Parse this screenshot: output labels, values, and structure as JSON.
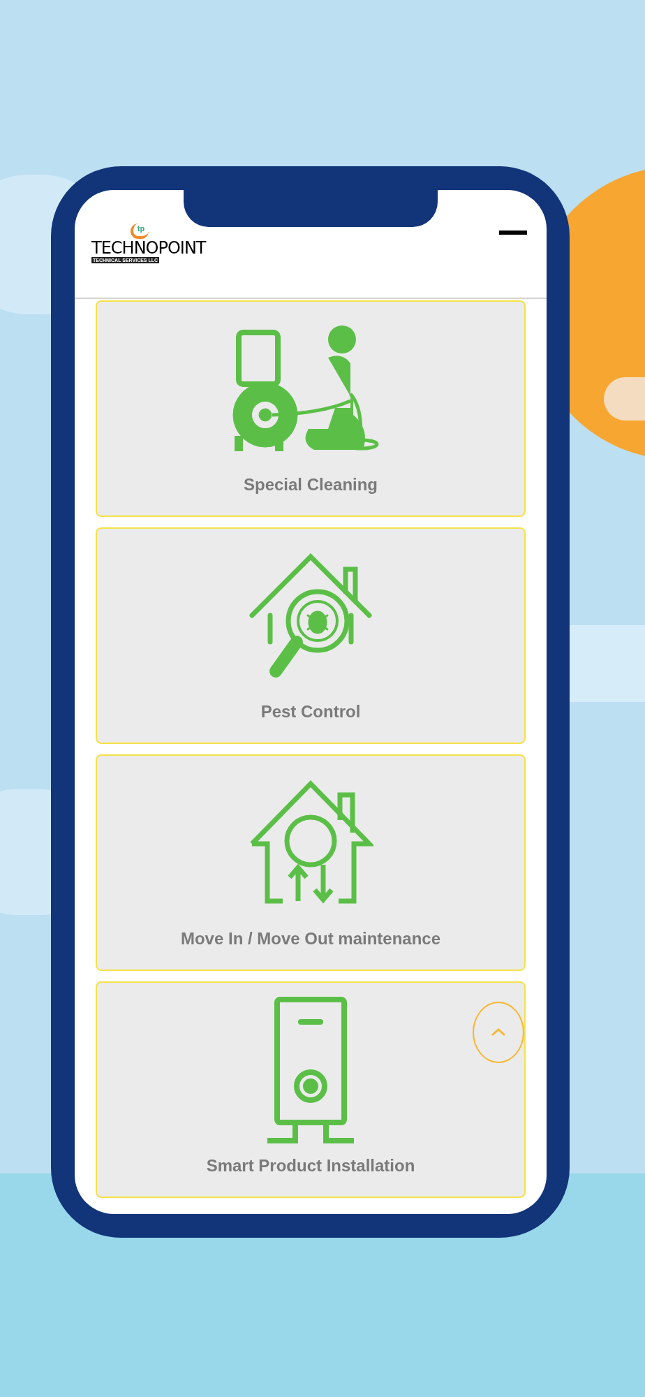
{
  "header": {
    "logo": {
      "emblem": "tp",
      "name": "TECHNOPOINT",
      "tagline": "TECHNICAL SERVICES LLC"
    }
  },
  "services": [
    {
      "kind": "cleaning",
      "label": "Special Cleaning"
    },
    {
      "kind": "pest",
      "label": "Pest Control"
    },
    {
      "kind": "move",
      "label": "Move In / Move Out maintenance"
    },
    {
      "kind": "appliance",
      "label": "Smart Product Installation"
    }
  ]
}
